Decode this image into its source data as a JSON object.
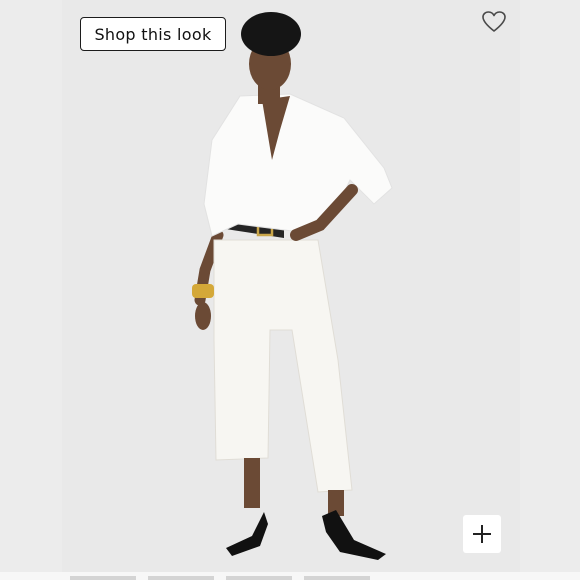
{
  "shop_button": {
    "label": "Shop this look"
  },
  "icons": {
    "favorite": "heart-icon",
    "zoom": "plus-icon"
  },
  "colors": {
    "photo_background": "#e9e9e9",
    "side_panel": "#ececec",
    "button_border": "#1c1c1c"
  }
}
